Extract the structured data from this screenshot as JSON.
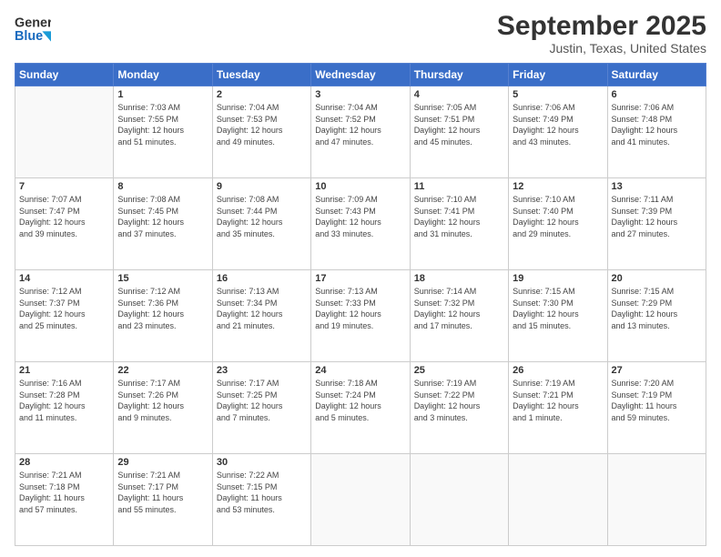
{
  "header": {
    "logo_text_general": "General",
    "logo_text_blue": "Blue",
    "title": "September 2025",
    "subtitle": "Justin, Texas, United States"
  },
  "days_of_week": [
    "Sunday",
    "Monday",
    "Tuesday",
    "Wednesday",
    "Thursday",
    "Friday",
    "Saturday"
  ],
  "weeks": [
    [
      {
        "day": "",
        "info": ""
      },
      {
        "day": "1",
        "info": "Sunrise: 7:03 AM\nSunset: 7:55 PM\nDaylight: 12 hours\nand 51 minutes."
      },
      {
        "day": "2",
        "info": "Sunrise: 7:04 AM\nSunset: 7:53 PM\nDaylight: 12 hours\nand 49 minutes."
      },
      {
        "day": "3",
        "info": "Sunrise: 7:04 AM\nSunset: 7:52 PM\nDaylight: 12 hours\nand 47 minutes."
      },
      {
        "day": "4",
        "info": "Sunrise: 7:05 AM\nSunset: 7:51 PM\nDaylight: 12 hours\nand 45 minutes."
      },
      {
        "day": "5",
        "info": "Sunrise: 7:06 AM\nSunset: 7:49 PM\nDaylight: 12 hours\nand 43 minutes."
      },
      {
        "day": "6",
        "info": "Sunrise: 7:06 AM\nSunset: 7:48 PM\nDaylight: 12 hours\nand 41 minutes."
      }
    ],
    [
      {
        "day": "7",
        "info": "Sunrise: 7:07 AM\nSunset: 7:47 PM\nDaylight: 12 hours\nand 39 minutes."
      },
      {
        "day": "8",
        "info": "Sunrise: 7:08 AM\nSunset: 7:45 PM\nDaylight: 12 hours\nand 37 minutes."
      },
      {
        "day": "9",
        "info": "Sunrise: 7:08 AM\nSunset: 7:44 PM\nDaylight: 12 hours\nand 35 minutes."
      },
      {
        "day": "10",
        "info": "Sunrise: 7:09 AM\nSunset: 7:43 PM\nDaylight: 12 hours\nand 33 minutes."
      },
      {
        "day": "11",
        "info": "Sunrise: 7:10 AM\nSunset: 7:41 PM\nDaylight: 12 hours\nand 31 minutes."
      },
      {
        "day": "12",
        "info": "Sunrise: 7:10 AM\nSunset: 7:40 PM\nDaylight: 12 hours\nand 29 minutes."
      },
      {
        "day": "13",
        "info": "Sunrise: 7:11 AM\nSunset: 7:39 PM\nDaylight: 12 hours\nand 27 minutes."
      }
    ],
    [
      {
        "day": "14",
        "info": "Sunrise: 7:12 AM\nSunset: 7:37 PM\nDaylight: 12 hours\nand 25 minutes."
      },
      {
        "day": "15",
        "info": "Sunrise: 7:12 AM\nSunset: 7:36 PM\nDaylight: 12 hours\nand 23 minutes."
      },
      {
        "day": "16",
        "info": "Sunrise: 7:13 AM\nSunset: 7:34 PM\nDaylight: 12 hours\nand 21 minutes."
      },
      {
        "day": "17",
        "info": "Sunrise: 7:13 AM\nSunset: 7:33 PM\nDaylight: 12 hours\nand 19 minutes."
      },
      {
        "day": "18",
        "info": "Sunrise: 7:14 AM\nSunset: 7:32 PM\nDaylight: 12 hours\nand 17 minutes."
      },
      {
        "day": "19",
        "info": "Sunrise: 7:15 AM\nSunset: 7:30 PM\nDaylight: 12 hours\nand 15 minutes."
      },
      {
        "day": "20",
        "info": "Sunrise: 7:15 AM\nSunset: 7:29 PM\nDaylight: 12 hours\nand 13 minutes."
      }
    ],
    [
      {
        "day": "21",
        "info": "Sunrise: 7:16 AM\nSunset: 7:28 PM\nDaylight: 12 hours\nand 11 minutes."
      },
      {
        "day": "22",
        "info": "Sunrise: 7:17 AM\nSunset: 7:26 PM\nDaylight: 12 hours\nand 9 minutes."
      },
      {
        "day": "23",
        "info": "Sunrise: 7:17 AM\nSunset: 7:25 PM\nDaylight: 12 hours\nand 7 minutes."
      },
      {
        "day": "24",
        "info": "Sunrise: 7:18 AM\nSunset: 7:24 PM\nDaylight: 12 hours\nand 5 minutes."
      },
      {
        "day": "25",
        "info": "Sunrise: 7:19 AM\nSunset: 7:22 PM\nDaylight: 12 hours\nand 3 minutes."
      },
      {
        "day": "26",
        "info": "Sunrise: 7:19 AM\nSunset: 7:21 PM\nDaylight: 12 hours\nand 1 minute."
      },
      {
        "day": "27",
        "info": "Sunrise: 7:20 AM\nSunset: 7:19 PM\nDaylight: 11 hours\nand 59 minutes."
      }
    ],
    [
      {
        "day": "28",
        "info": "Sunrise: 7:21 AM\nSunset: 7:18 PM\nDaylight: 11 hours\nand 57 minutes."
      },
      {
        "day": "29",
        "info": "Sunrise: 7:21 AM\nSunset: 7:17 PM\nDaylight: 11 hours\nand 55 minutes."
      },
      {
        "day": "30",
        "info": "Sunrise: 7:22 AM\nSunset: 7:15 PM\nDaylight: 11 hours\nand 53 minutes."
      },
      {
        "day": "",
        "info": ""
      },
      {
        "day": "",
        "info": ""
      },
      {
        "day": "",
        "info": ""
      },
      {
        "day": "",
        "info": ""
      }
    ]
  ]
}
